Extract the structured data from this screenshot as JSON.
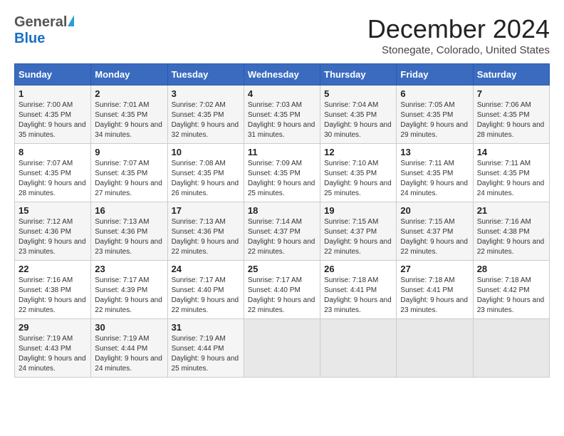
{
  "header": {
    "logo_general": "General",
    "logo_blue": "Blue",
    "main_title": "December 2024",
    "subtitle": "Stonegate, Colorado, United States"
  },
  "calendar": {
    "headers": [
      "Sunday",
      "Monday",
      "Tuesday",
      "Wednesday",
      "Thursday",
      "Friday",
      "Saturday"
    ],
    "weeks": [
      [
        {
          "day": "",
          "empty": true
        },
        {
          "day": "",
          "empty": true
        },
        {
          "day": "",
          "empty": true
        },
        {
          "day": "",
          "empty": true
        },
        {
          "day": "",
          "empty": true
        },
        {
          "day": "",
          "empty": true
        },
        {
          "day": "",
          "empty": true
        }
      ],
      [
        {
          "day": "1",
          "sunrise": "7:00 AM",
          "sunset": "4:35 PM",
          "daylight": "9 hours and 35 minutes."
        },
        {
          "day": "2",
          "sunrise": "7:01 AM",
          "sunset": "4:35 PM",
          "daylight": "9 hours and 34 minutes."
        },
        {
          "day": "3",
          "sunrise": "7:02 AM",
          "sunset": "4:35 PM",
          "daylight": "9 hours and 32 minutes."
        },
        {
          "day": "4",
          "sunrise": "7:03 AM",
          "sunset": "4:35 PM",
          "daylight": "9 hours and 31 minutes."
        },
        {
          "day": "5",
          "sunrise": "7:04 AM",
          "sunset": "4:35 PM",
          "daylight": "9 hours and 30 minutes."
        },
        {
          "day": "6",
          "sunrise": "7:05 AM",
          "sunset": "4:35 PM",
          "daylight": "9 hours and 29 minutes."
        },
        {
          "day": "7",
          "sunrise": "7:06 AM",
          "sunset": "4:35 PM",
          "daylight": "9 hours and 28 minutes."
        }
      ],
      [
        {
          "day": "8",
          "sunrise": "7:07 AM",
          "sunset": "4:35 PM",
          "daylight": "9 hours and 28 minutes."
        },
        {
          "day": "9",
          "sunrise": "7:07 AM",
          "sunset": "4:35 PM",
          "daylight": "9 hours and 27 minutes."
        },
        {
          "day": "10",
          "sunrise": "7:08 AM",
          "sunset": "4:35 PM",
          "daylight": "9 hours and 26 minutes."
        },
        {
          "day": "11",
          "sunrise": "7:09 AM",
          "sunset": "4:35 PM",
          "daylight": "9 hours and 25 minutes."
        },
        {
          "day": "12",
          "sunrise": "7:10 AM",
          "sunset": "4:35 PM",
          "daylight": "9 hours and 25 minutes."
        },
        {
          "day": "13",
          "sunrise": "7:11 AM",
          "sunset": "4:35 PM",
          "daylight": "9 hours and 24 minutes."
        },
        {
          "day": "14",
          "sunrise": "7:11 AM",
          "sunset": "4:35 PM",
          "daylight": "9 hours and 24 minutes."
        }
      ],
      [
        {
          "day": "15",
          "sunrise": "7:12 AM",
          "sunset": "4:36 PM",
          "daylight": "9 hours and 23 minutes."
        },
        {
          "day": "16",
          "sunrise": "7:13 AM",
          "sunset": "4:36 PM",
          "daylight": "9 hours and 23 minutes."
        },
        {
          "day": "17",
          "sunrise": "7:13 AM",
          "sunset": "4:36 PM",
          "daylight": "9 hours and 22 minutes."
        },
        {
          "day": "18",
          "sunrise": "7:14 AM",
          "sunset": "4:37 PM",
          "daylight": "9 hours and 22 minutes."
        },
        {
          "day": "19",
          "sunrise": "7:15 AM",
          "sunset": "4:37 PM",
          "daylight": "9 hours and 22 minutes."
        },
        {
          "day": "20",
          "sunrise": "7:15 AM",
          "sunset": "4:37 PM",
          "daylight": "9 hours and 22 minutes."
        },
        {
          "day": "21",
          "sunrise": "7:16 AM",
          "sunset": "4:38 PM",
          "daylight": "9 hours and 22 minutes."
        }
      ],
      [
        {
          "day": "22",
          "sunrise": "7:16 AM",
          "sunset": "4:38 PM",
          "daylight": "9 hours and 22 minutes."
        },
        {
          "day": "23",
          "sunrise": "7:17 AM",
          "sunset": "4:39 PM",
          "daylight": "9 hours and 22 minutes."
        },
        {
          "day": "24",
          "sunrise": "7:17 AM",
          "sunset": "4:40 PM",
          "daylight": "9 hours and 22 minutes."
        },
        {
          "day": "25",
          "sunrise": "7:17 AM",
          "sunset": "4:40 PM",
          "daylight": "9 hours and 22 minutes."
        },
        {
          "day": "26",
          "sunrise": "7:18 AM",
          "sunset": "4:41 PM",
          "daylight": "9 hours and 23 minutes."
        },
        {
          "day": "27",
          "sunrise": "7:18 AM",
          "sunset": "4:41 PM",
          "daylight": "9 hours and 23 minutes."
        },
        {
          "day": "28",
          "sunrise": "7:18 AM",
          "sunset": "4:42 PM",
          "daylight": "9 hours and 23 minutes."
        }
      ],
      [
        {
          "day": "29",
          "sunrise": "7:19 AM",
          "sunset": "4:43 PM",
          "daylight": "9 hours and 24 minutes."
        },
        {
          "day": "30",
          "sunrise": "7:19 AM",
          "sunset": "4:44 PM",
          "daylight": "9 hours and 24 minutes."
        },
        {
          "day": "31",
          "sunrise": "7:19 AM",
          "sunset": "4:44 PM",
          "daylight": "9 hours and 25 minutes."
        },
        {
          "day": "",
          "empty": true
        },
        {
          "day": "",
          "empty": true
        },
        {
          "day": "",
          "empty": true
        },
        {
          "day": "",
          "empty": true
        }
      ]
    ]
  },
  "labels": {
    "sunrise_prefix": "Sunrise: ",
    "sunset_prefix": "Sunset: ",
    "daylight_prefix": "Daylight: "
  }
}
